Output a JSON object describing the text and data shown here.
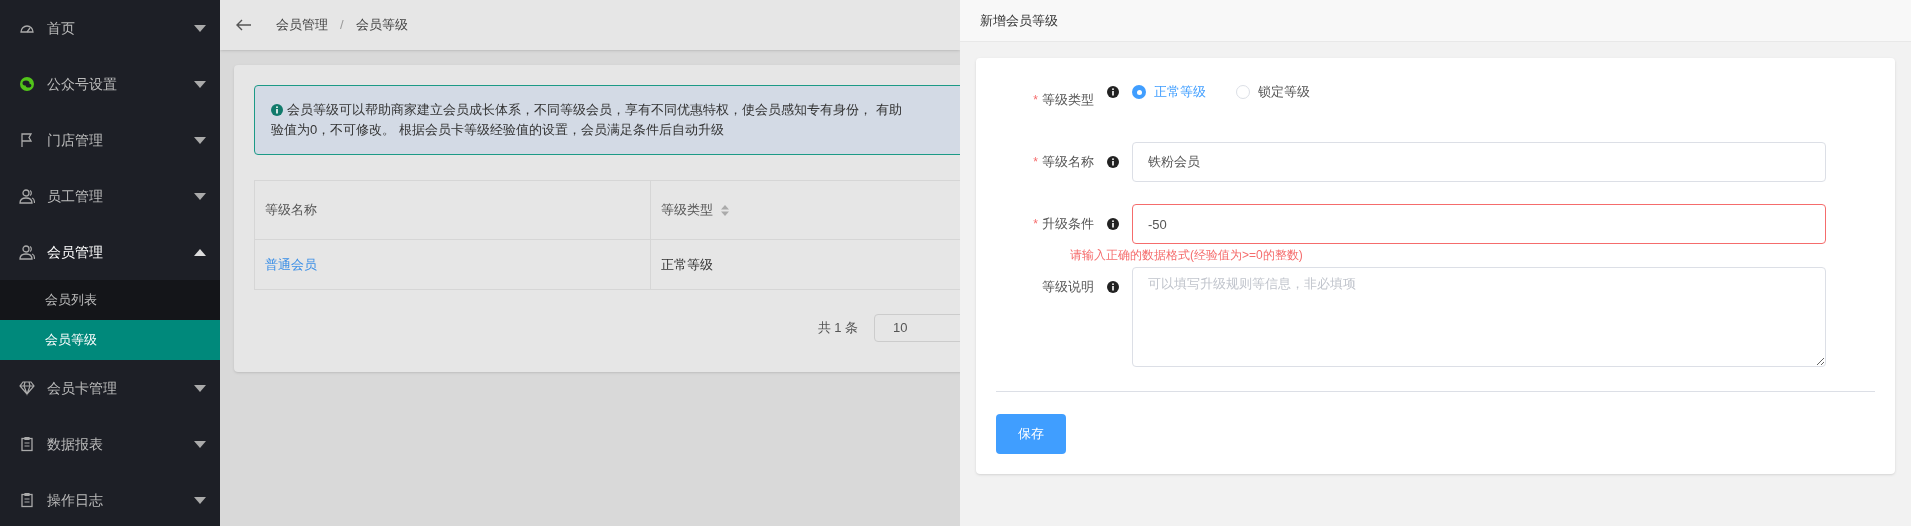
{
  "sidebar": {
    "items": [
      {
        "label": "首页",
        "kind": "gauge",
        "expanded": false
      },
      {
        "label": "公众号设置",
        "kind": "wechat",
        "expanded": false
      },
      {
        "label": "门店管理",
        "kind": "flag",
        "expanded": false
      },
      {
        "label": "员工管理",
        "kind": "user",
        "expanded": false
      },
      {
        "label": "会员管理",
        "kind": "user",
        "expanded": true,
        "children": [
          {
            "label": "会员列表",
            "selected": false
          },
          {
            "label": "会员等级",
            "selected": true
          }
        ]
      },
      {
        "label": "会员卡管理",
        "kind": "diamond",
        "expanded": false
      },
      {
        "label": "数据报表",
        "kind": "clipboard",
        "expanded": false
      },
      {
        "label": "操作日志",
        "kind": "clipboard",
        "expanded": false
      }
    ]
  },
  "breadcrumb": {
    "items": [
      "会员管理",
      "会员等级"
    ],
    "separator": "/"
  },
  "alert": {
    "lines": [
      "会员等级可以帮助商家建立会员成长体系，不同等级会员，享有不同优惠特权，使会员感知专有身份， 有助",
      "验值为0，不可修改。 根据会员卡等级经验值的设置，会员满足条件后自动升级"
    ]
  },
  "table": {
    "columns": [
      {
        "label": "等级名称",
        "sortable": false
      },
      {
        "label": "等级类型",
        "sortable": true
      }
    ],
    "rows": [
      [
        "普通会员",
        "正常等级"
      ]
    ]
  },
  "pagination": {
    "total": "共 1 条",
    "page_size": "10"
  },
  "drawer": {
    "title": "新增会员等级",
    "fields": [
      {
        "kind": "radio",
        "label": "等级类型",
        "required_mark": "*",
        "options": [
          {
            "label": "正常等级",
            "selected": true
          },
          {
            "label": "锁定等级",
            "selected": false
          }
        ]
      },
      {
        "kind": "input",
        "label": "等级名称",
        "required_mark": "*",
        "value": "铁粉会员"
      },
      {
        "kind": "input",
        "label": "升级条件",
        "required_mark": "*",
        "value": "-50",
        "error": "请输入正确的数据格式(经验值为>=0的整数)"
      },
      {
        "kind": "textarea",
        "label": "等级说明",
        "placeholder": "可以填写升级规则等信息，非必填项"
      }
    ],
    "save_button": "保存"
  }
}
